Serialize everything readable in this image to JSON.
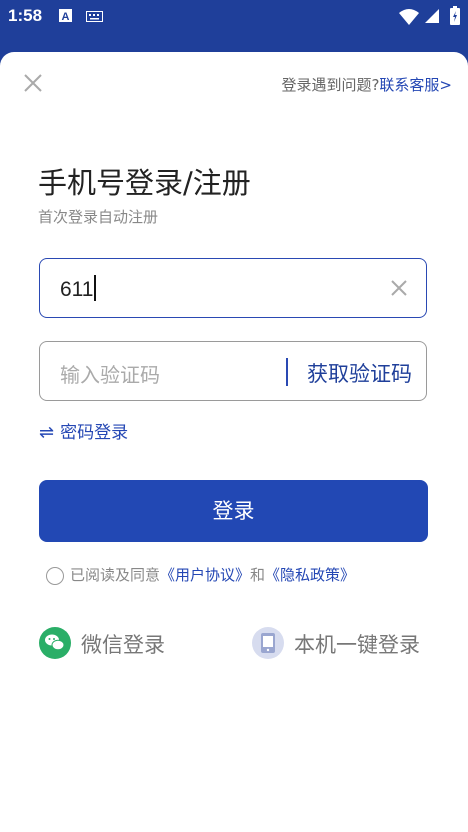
{
  "status_bar": {
    "time": "1:58"
  },
  "top": {
    "help_text": "登录遇到问题?",
    "support_link": "联系客服>"
  },
  "header": {
    "title": "手机号登录/注册",
    "subtitle": "首次登录自动注册"
  },
  "phone_field": {
    "value": "611"
  },
  "code_field": {
    "placeholder": "输入验证码",
    "get_code_label": "获取验证码"
  },
  "password_login": {
    "label": "密码登录"
  },
  "login_button": {
    "label": "登录"
  },
  "agreement": {
    "prefix": "已阅读及同意",
    "user_agreement": "《用户协议》",
    "and": "和",
    "privacy_policy": "《隐私政策》",
    "checked": false
  },
  "alt_logins": {
    "wechat": "微信登录",
    "one_key": "本机一键登录"
  },
  "colors": {
    "brand": "#2248b4",
    "header_bg": "#1f3f9a",
    "wechat_green": "#2aae67"
  }
}
